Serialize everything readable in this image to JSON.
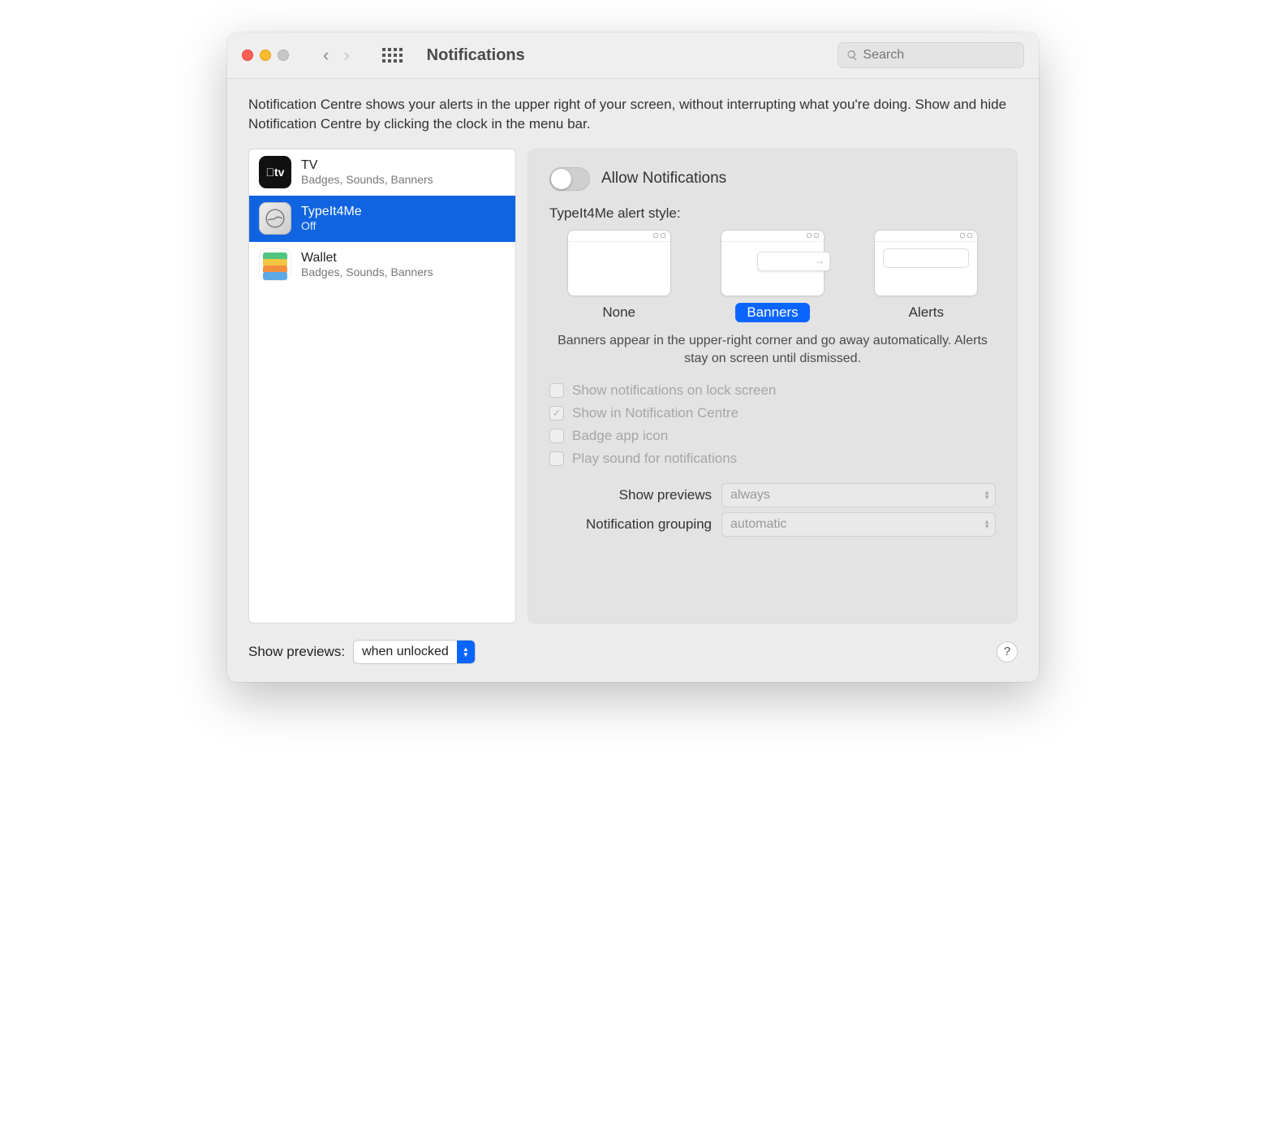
{
  "window": {
    "title": "Notifications",
    "search_placeholder": "Search"
  },
  "intro": "Notification Centre shows your alerts in the upper right of your screen, without interrupting what you're doing. Show and hide Notification Centre by clicking the clock in the menu bar.",
  "apps": [
    {
      "name": "TV",
      "sub": "Badges, Sounds, Banners",
      "selected": false,
      "icon": "tv"
    },
    {
      "name": "TypeIt4Me",
      "sub": "Off",
      "selected": true,
      "icon": "ti"
    },
    {
      "name": "Wallet",
      "sub": "Badges, Sounds, Banners",
      "selected": false,
      "icon": "wallet"
    }
  ],
  "detail": {
    "allow_label": "Allow Notifications",
    "allow_on": false,
    "style_heading": "TypeIt4Me alert style:",
    "styles": [
      {
        "key": "none",
        "label": "None",
        "selected": false
      },
      {
        "key": "banners",
        "label": "Banners",
        "selected": true
      },
      {
        "key": "alerts",
        "label": "Alerts",
        "selected": false
      }
    ],
    "style_description": "Banners appear in the upper-right corner and go away automatically. Alerts stay on screen until dismissed.",
    "checks": [
      {
        "label": "Show notifications on lock screen",
        "checked": false
      },
      {
        "label": "Show in Notification Centre",
        "checked": true
      },
      {
        "label": "Badge app icon",
        "checked": false
      },
      {
        "label": "Play sound for notifications",
        "checked": false
      }
    ],
    "show_previews_label": "Show previews",
    "show_previews_value": "always",
    "grouping_label": "Notification grouping",
    "grouping_value": "automatic"
  },
  "footer": {
    "show_previews_label": "Show previews:",
    "show_previews_value": "when unlocked"
  }
}
